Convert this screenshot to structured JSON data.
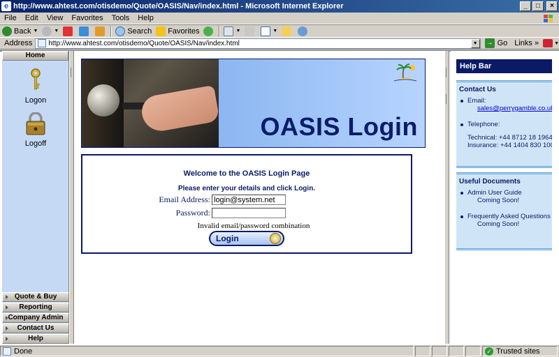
{
  "window": {
    "title": "http://www.ahtest.com/otisdemo/Quote/OASIS/Nav/index.html - Microsoft Internet Explorer",
    "icon": "ie-icon"
  },
  "menubar": {
    "items": [
      {
        "label": "File"
      },
      {
        "label": "Edit"
      },
      {
        "label": "View"
      },
      {
        "label": "Favorites"
      },
      {
        "label": "Tools"
      },
      {
        "label": "Help"
      }
    ]
  },
  "toolbar": {
    "back_label": "Back",
    "search_label": "Search",
    "favorites_label": "Favorites"
  },
  "addressbar": {
    "label": "Address",
    "url": "http://www.ahtest.com/otisdemo/Quote/OASIS/Nav/index.html",
    "go_label": "Go",
    "links_label": "Links"
  },
  "leftnav": {
    "home_label": "Home",
    "logon_label": "Logon",
    "logoff_label": "Logoff",
    "bottom_items": [
      {
        "label": "Quote & Buy"
      },
      {
        "label": "Reporting"
      },
      {
        "label": "Company Admin"
      },
      {
        "label": "Contact Us"
      },
      {
        "label": "Help"
      }
    ]
  },
  "banner": {
    "title": "OASIS Login"
  },
  "login": {
    "welcome": "Welcome to the OASIS Login Page",
    "instructions": "Please enter your details and click Login.",
    "email_label": "Email Address:",
    "email_value": "login@system.net",
    "password_label": "Password:",
    "password_value": "",
    "error": "Invalid email/password combination",
    "button_label": "Login"
  },
  "helpbar": {
    "title": "Help Bar",
    "contact": {
      "heading": "Contact Us",
      "email_label": "Email:",
      "email_value": "sales@perrygamble.co.uk",
      "telephone_label": "Telephone:",
      "technical": "Technical: +44 8712 18 1964",
      "insurance": "Insurance: +44 1404 830 100"
    },
    "documents": {
      "heading": "Useful Documents",
      "items": [
        {
          "title": "Admin User Guide",
          "status": "Coming Soon!"
        },
        {
          "title": "Frequently Asked Questions",
          "status": "Coming Soon!"
        }
      ]
    }
  },
  "statusbar": {
    "status": "Done",
    "zone": "Trusted sites"
  },
  "colors": {
    "navy": "#0a1a66",
    "nav_bg": "#c5d9f5",
    "panel_bg": "#cfe5f7"
  }
}
